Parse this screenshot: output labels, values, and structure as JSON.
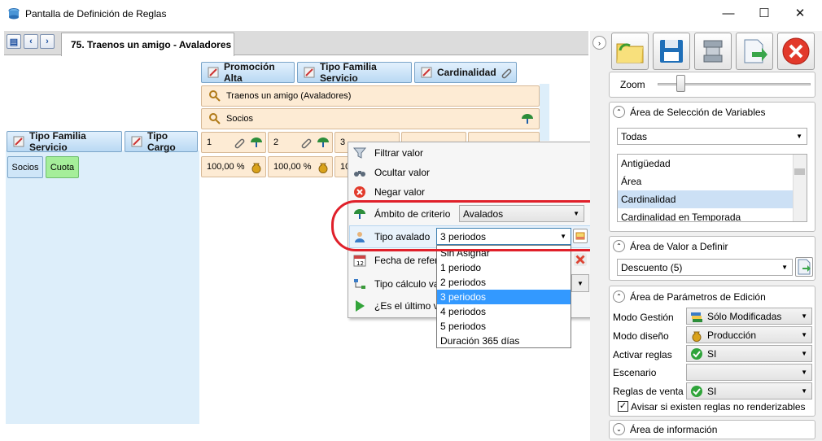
{
  "window": {
    "title": "Pantalla de Definición de Reglas",
    "minimize": "—",
    "maximize": "☐",
    "close": "✕"
  },
  "tab": {
    "label": "75. Traenos un amigo - Avaladores"
  },
  "headers": {
    "col": [
      {
        "label": "Promoción Alta"
      },
      {
        "label": "Tipo Familia Servicio"
      },
      {
        "label": "Cardinalidad"
      }
    ],
    "row": [
      {
        "label": "Tipo Familia Servicio"
      },
      {
        "label": "Tipo Cargo"
      }
    ]
  },
  "promo_cells": {
    "p1": "Traenos un amigo (Avaladores)",
    "p2": "Socios"
  },
  "card_cells": [
    "1",
    "2",
    "3"
  ],
  "row_chips": {
    "socios": "Socios",
    "cuota": "Cuota"
  },
  "values": [
    "100,00 %",
    "100,00 %",
    "10"
  ],
  "context_menu": {
    "filtrar": "Filtrar valor",
    "ocultar": "Ocultar valor",
    "negar": "Negar valor",
    "ambito_label": "Ámbito de criterio",
    "ambito_value": "Avalados",
    "tipo_label": "Tipo avalado",
    "tipo_value": "3 periodos",
    "fecha_label": "Fecha de refer",
    "calculo_label": "Tipo cálculo va",
    "ultimo_label": "¿Es el último v"
  },
  "dropdown": {
    "options": [
      "Sin Asignar",
      "1 periodo",
      "2 periodos",
      "3 periodos",
      "4 periodos",
      "5 periodos",
      "Duración 365 días"
    ],
    "selected": "3 periodos"
  },
  "right": {
    "zoom_label": "Zoom",
    "zoom_level": 0.12,
    "seleccion": {
      "title": "Área de Selección de Variables",
      "combo": "Todas",
      "items": [
        "Antigüedad",
        "Área",
        "Cardinalidad",
        "Cardinalidad en Temporada"
      ],
      "selected": "Cardinalidad"
    },
    "valor": {
      "title": "Área de Valor a Definir",
      "combo": "Descuento (5)"
    },
    "parametros": {
      "title": "Área de Parámetros de Edición",
      "rows": [
        {
          "label": "Modo Gestión",
          "value": "Sólo Modificadas"
        },
        {
          "label": "Modo diseño",
          "value": "Producción"
        },
        {
          "label": "Activar reglas",
          "value": "SI"
        },
        {
          "label": "Escenario",
          "value": ""
        },
        {
          "label": "Reglas de venta",
          "value": "SI"
        }
      ],
      "checkbox": "Avisar si existen reglas no renderizables",
      "checked": true
    },
    "info": {
      "title": "Área de información"
    }
  },
  "colors": {
    "accent": "#3399ff",
    "highlight_oval": "#e0202a",
    "header_blue": "#b9d9f3",
    "peach": "#fdebd4",
    "green_chip": "#a5ee9a"
  }
}
